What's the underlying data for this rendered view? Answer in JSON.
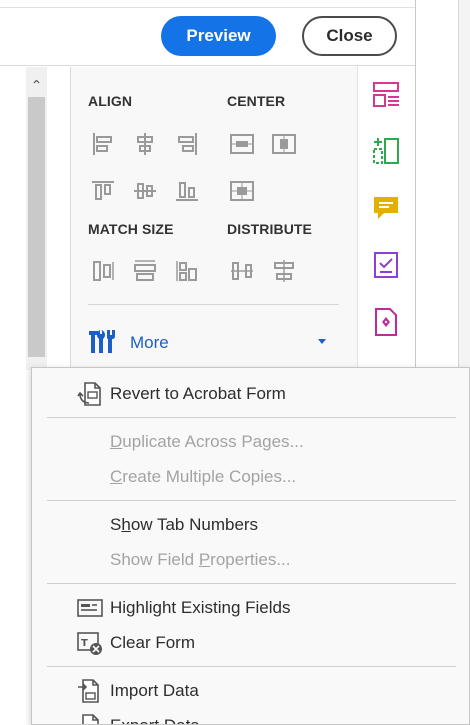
{
  "topbar": {
    "preview_label": "Preview",
    "close_label": "Close"
  },
  "panel": {
    "align_label": "ALIGN",
    "center_label": "CENTER",
    "match_size_label": "MATCH SIZE",
    "distribute_label": "DISTRIBUTE",
    "more_label": "More"
  },
  "tool_icons": {
    "align": [
      "align-left-icon",
      "align-horizontal-center-icon",
      "align-right-icon",
      "align-top-icon",
      "align-vertical-center-icon",
      "align-bottom-icon"
    ],
    "center": [
      "center-horizontally-icon",
      "center-vertically-icon",
      "center-both-icon"
    ],
    "match_size": [
      "match-width-icon",
      "match-height-icon",
      "match-both-icon"
    ],
    "distribute": [
      "distribute-horizontally-icon",
      "distribute-vertically-icon"
    ]
  },
  "rail_icons": [
    {
      "name": "prepare-form-icon",
      "color": "#d83790"
    },
    {
      "name": "organize-pages-icon",
      "color": "#2fa84f"
    },
    {
      "name": "comment-icon",
      "color": "#e2b100"
    },
    {
      "name": "fill-sign-icon",
      "color": "#8b3fd6"
    },
    {
      "name": "request-signature-icon",
      "color": "#c4299b"
    }
  ],
  "menu": {
    "revert": "Revert to Acrobat Form",
    "duplicate": {
      "pre": "",
      "ul": "D",
      "post": "uplicate Across Pages..."
    },
    "create_copies": {
      "pre": "",
      "ul": "C",
      "post": "reate Multiple Copies..."
    },
    "show_tab_numbers": {
      "pre": "S",
      "ul": "h",
      "post": "ow Tab Numbers"
    },
    "show_field_properties": {
      "pre": "Show Field ",
      "ul": "P",
      "post": "roperties..."
    },
    "highlight_fields": "Highlight Existing Fields",
    "clear_form": "Clear Form",
    "import_data": "Import Data",
    "export_data": "Export Data"
  },
  "colors": {
    "accent_blue": "#1473e6",
    "more_blue": "#1b5fc7"
  }
}
